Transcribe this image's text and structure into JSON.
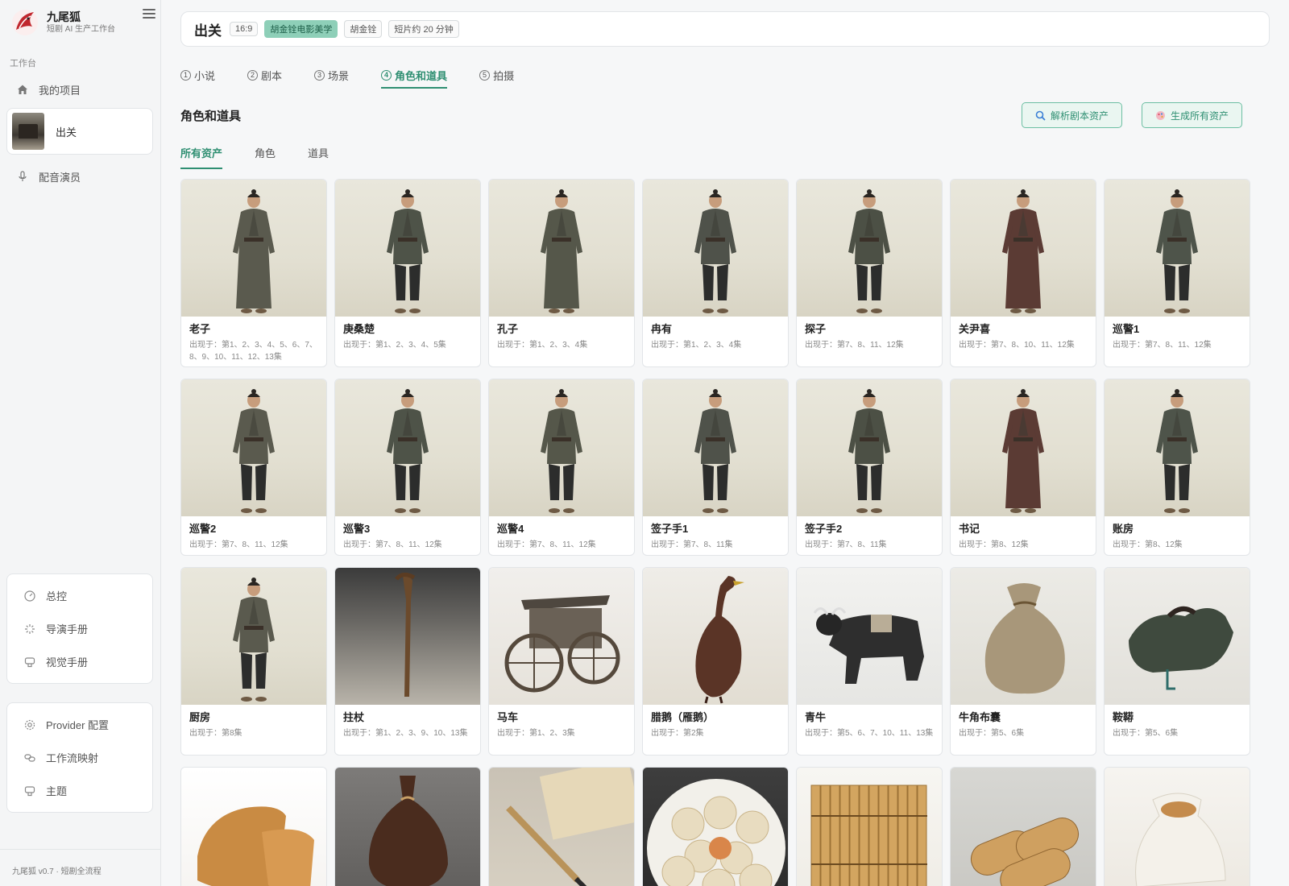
{
  "brand": {
    "name": "九尾狐",
    "subtitle": "短剧 AI 生产工作台"
  },
  "nav": {
    "section_label": "工作台",
    "my_projects": "我的项目",
    "current_project": "出关",
    "voice_actors": "配音演员"
  },
  "panel_tools": [
    "总控",
    "导演手册",
    "视觉手册"
  ],
  "panel_settings": [
    "Provider 配置",
    "工作流映射",
    "主题"
  ],
  "version": "九尾狐 v0.7 · 短剧全流程",
  "header": {
    "title": "出关",
    "chips": [
      "16:9",
      "胡金铨电影美学",
      "胡金铨",
      "短片约 20 分钟"
    ]
  },
  "steps": [
    {
      "num": "1",
      "label": "小说"
    },
    {
      "num": "2",
      "label": "剧本"
    },
    {
      "num": "3",
      "label": "场景"
    },
    {
      "num": "4",
      "label": "角色和道具"
    },
    {
      "num": "5",
      "label": "拍摄"
    }
  ],
  "section_title": "角色和道具",
  "actions": {
    "parse": "解析剧本资产",
    "generate": "生成所有资产"
  },
  "subtabs": [
    "所有资产",
    "角色",
    "道具"
  ],
  "colors": {
    "accent": "#2f8f72",
    "accent_soft": "#eaf6f1",
    "chip_accent": "#8ecfb8"
  },
  "assets": [
    {
      "name": "老子",
      "meta": "出现于：第1、2、3、4、5、6、7、8、9、10、11、12、13集",
      "kind": "person"
    },
    {
      "name": "庚桑楚",
      "meta": "出现于：第1、2、3、4、5集",
      "kind": "person"
    },
    {
      "name": "孔子",
      "meta": "出现于：第1、2、3、4集",
      "kind": "person"
    },
    {
      "name": "冉有",
      "meta": "出现于：第1、2、3、4集",
      "kind": "person"
    },
    {
      "name": "探子",
      "meta": "出现于：第7、8、11、12集",
      "kind": "person"
    },
    {
      "name": "关尹喜",
      "meta": "出现于：第7、8、10、11、12集",
      "kind": "person"
    },
    {
      "name": "巡警1",
      "meta": "出现于：第7、8、11、12集",
      "kind": "person"
    },
    {
      "name": "巡警2",
      "meta": "出现于：第7、8、11、12集",
      "kind": "person"
    },
    {
      "name": "巡警3",
      "meta": "出现于：第7、8、11、12集",
      "kind": "person"
    },
    {
      "name": "巡警4",
      "meta": "出现于：第7、8、11、12集",
      "kind": "person"
    },
    {
      "name": "签子手1",
      "meta": "出现于：第7、8、11集",
      "kind": "person"
    },
    {
      "name": "签子手2",
      "meta": "出现于：第7、8、11集",
      "kind": "person"
    },
    {
      "name": "书记",
      "meta": "出现于：第8、12集",
      "kind": "person"
    },
    {
      "name": "账房",
      "meta": "出现于：第8、12集",
      "kind": "person"
    },
    {
      "name": "厨房",
      "meta": "出现于：第8集",
      "kind": "person"
    },
    {
      "name": "拄杖",
      "meta": "出现于：第1、2、3、9、10、13集",
      "kind": "staff"
    },
    {
      "name": "马车",
      "meta": "出现于：第1、2、3集",
      "kind": "cart"
    },
    {
      "name": "腊鹅（雁鹅）",
      "meta": "出现于：第2集",
      "kind": "goose"
    },
    {
      "name": "青牛",
      "meta": "出现于：第5、6、7、10、11、13集",
      "kind": "ox"
    },
    {
      "name": "牛角布囊",
      "meta": "出现于：第5、6集",
      "kind": "bag"
    },
    {
      "name": "鞍鞯",
      "meta": "出现于：第5、6集",
      "kind": "saddle"
    },
    {
      "name": "",
      "meta": "",
      "kind": "bread"
    },
    {
      "name": "",
      "meta": "",
      "kind": "pouch"
    },
    {
      "name": "",
      "meta": "",
      "kind": "brush"
    },
    {
      "name": "",
      "meta": "",
      "kind": "buns"
    },
    {
      "name": "",
      "meta": "",
      "kind": "slips"
    },
    {
      "name": "",
      "meta": "",
      "kind": "scrolls"
    },
    {
      "name": "",
      "meta": "",
      "kind": "sack"
    }
  ]
}
